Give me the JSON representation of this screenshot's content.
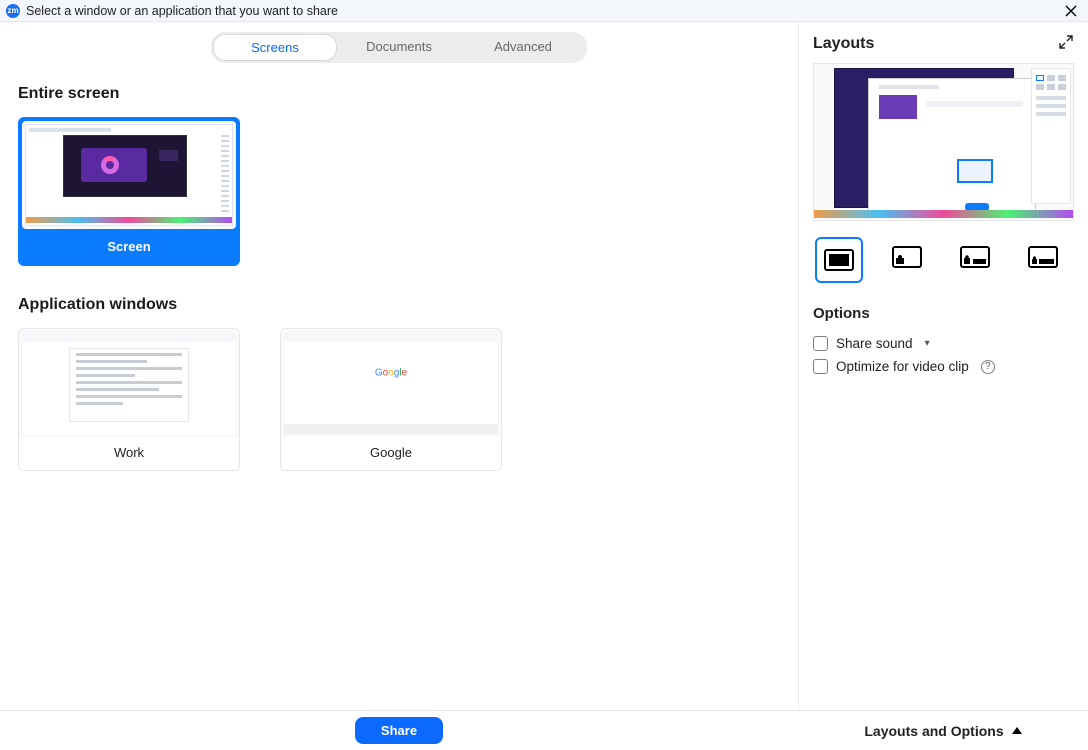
{
  "titlebar": {
    "app_icon_text": "zm",
    "title": "Select a window or an application that you want to share"
  },
  "tabs": {
    "screens": "Screens",
    "documents": "Documents",
    "advanced": "Advanced",
    "active": "Screens"
  },
  "sections": {
    "entire_screen_title": "Entire screen",
    "app_windows_title": "Application windows"
  },
  "screen_cards": [
    {
      "label": "Screen",
      "selected": true
    }
  ],
  "app_cards": [
    {
      "label": "Work"
    },
    {
      "label": "Google"
    }
  ],
  "sidebar": {
    "layouts_title": "Layouts",
    "options_title": "Options",
    "options": {
      "share_sound": "Share sound",
      "optimize_video": "Optimize for video clip"
    },
    "layout_modes": [
      "full",
      "pip-bl",
      "pip-br-small",
      "pip-br-wide"
    ],
    "layout_selected": "full"
  },
  "footer": {
    "share": "Share",
    "layouts_options": "Layouts and Options"
  }
}
